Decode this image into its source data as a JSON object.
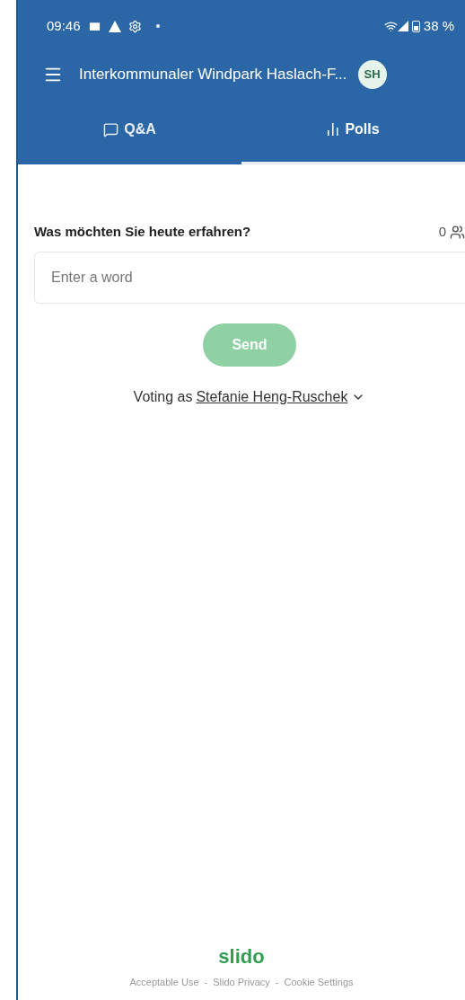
{
  "status_bar": {
    "time": "09:46",
    "battery": "38 %"
  },
  "app_bar": {
    "title": "Interkommunaler Windpark Haslach-F...",
    "avatar": "SH"
  },
  "tabs": [
    {
      "label": "Q&A",
      "kind": "qa",
      "selected": false
    },
    {
      "label": "Polls",
      "kind": "polls",
      "selected": true
    }
  ],
  "poll": {
    "question": "Was möchten Sie heute erfahren?",
    "participants": "0",
    "input": {
      "placeholder": "Enter a word"
    },
    "send": {
      "label": "Send",
      "disabled": true
    },
    "voting_as": {
      "prefix": "Voting as",
      "name": "Stefanie Heng-Ruschek"
    }
  },
  "footer": {
    "logo": "slido",
    "links": [
      "Acceptable Use",
      "Slido Privacy",
      "Cookie Settings"
    ],
    "separator": "-"
  }
}
